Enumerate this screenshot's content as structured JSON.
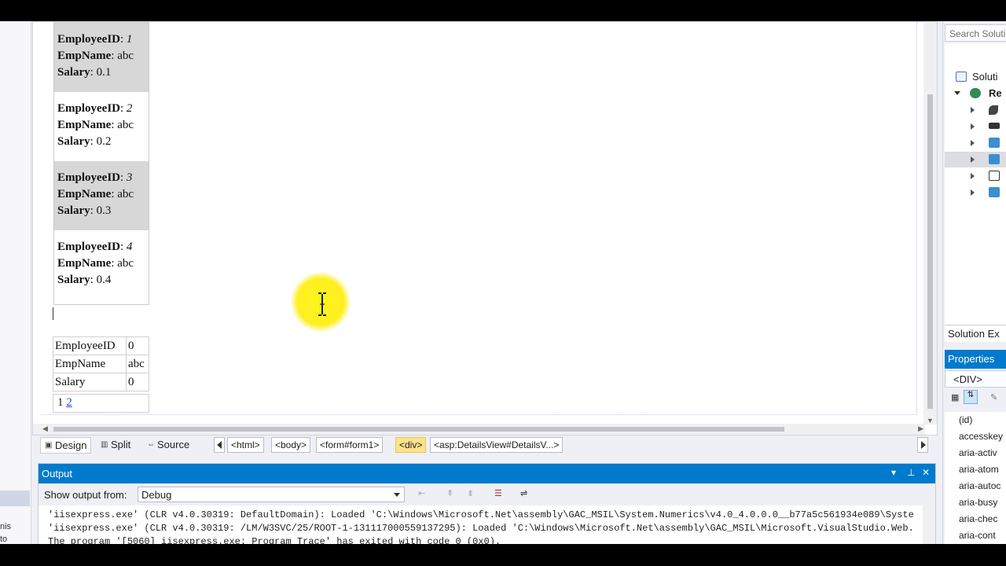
{
  "records": [
    {
      "id_label": "EmployeeID",
      "id_value": "1",
      "name_label": "EmpName",
      "name_value": "abc",
      "salary_label": "Salary",
      "salary_value": "0.1"
    },
    {
      "id_label": "EmployeeID",
      "id_value": "2",
      "name_label": "EmpName",
      "name_value": "abc",
      "salary_label": "Salary",
      "salary_value": "0.2"
    },
    {
      "id_label": "EmployeeID",
      "id_value": "3",
      "name_label": "EmpName",
      "name_value": "abc",
      "salary_label": "Salary",
      "salary_value": "0.3"
    },
    {
      "id_label": "EmployeeID",
      "id_value": "4",
      "name_label": "EmpName",
      "name_value": "abc",
      "salary_label": "Salary",
      "salary_value": "0.4"
    }
  ],
  "details": {
    "rows": [
      {
        "key": "EmployeeID",
        "value": "0"
      },
      {
        "key": "EmpName",
        "value": "abc"
      },
      {
        "key": "Salary",
        "value": "0"
      }
    ],
    "pager_current": "1",
    "pager_link": "2"
  },
  "viewbar": {
    "design": "Design",
    "split": "Split",
    "source": "Source",
    "crumbs": [
      "<html>",
      "<body>",
      "<form#form1>",
      "<div>",
      "<asp:DetailsView#DetailsV...>"
    ]
  },
  "output": {
    "title": "Output",
    "show_label": "Show output from:",
    "source": "Debug",
    "lines": [
      "'iisexpress.exe' (CLR v4.0.30319: DefaultDomain): Loaded 'C:\\Windows\\Microsoft.Net\\assembly\\GAC_MSIL\\System.Numerics\\v4.0_4.0.0.0__b77a5c561934e089\\Syste",
      "'iisexpress.exe' (CLR v4.0.30319: /LM/W3SVC/25/ROOT-1-131117000559137295): Loaded 'C:\\Windows\\Microsoft.Net\\assembly\\GAC_MSIL\\Microsoft.VisualStudio.Web.",
      "The program '[5060] iisexpress.exe: Program Trace' has exited with code 0 (0x0)."
    ]
  },
  "solution": {
    "search_placeholder": "Search Soluti",
    "root": "Soluti",
    "project": "Re",
    "tab": "Solution Ex"
  },
  "properties": {
    "title": "Properties",
    "object": "<DIV>",
    "items": [
      "(id)",
      "accesskey",
      "aria-activ",
      "aria-atom",
      "aria-autoc",
      "aria-busy",
      "aria-chec",
      "aria-cont"
    ]
  },
  "left_strip": {
    "frag1": "nis",
    "frag2": "to"
  },
  "colors": {
    "accent": "#007acc",
    "highlight": "#fde28a",
    "alt_row": "#d7d7d7"
  }
}
